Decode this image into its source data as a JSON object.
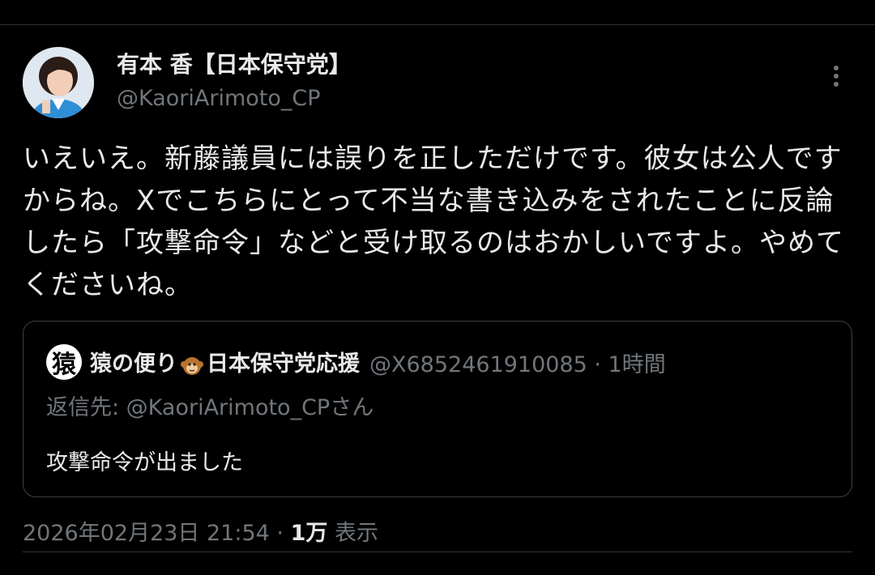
{
  "author": {
    "display_name": "有本 香【日本保守党】",
    "handle": "@KaoriArimoto_CP"
  },
  "tweet": {
    "text": "いえいえ。新藤議員には誤りを正しただけです。彼女は公人ですからね。Xでこちらにとって不当な書き込みをされたことに反論したら「攻撃命令」などと受け取るのはおかしいですよ。やめてくださいね。"
  },
  "quote": {
    "avatar_char": "猿",
    "name_part1": "猿の便り",
    "name_part2": "日本保守党応援",
    "handle_time": "@X6852461910085 · 1時間",
    "reply_to": "返信先: @KaoriArimoto_CPさん",
    "text": "攻撃命令が出ました"
  },
  "meta": {
    "timestamp": "2026年02月23日 21:54 · ",
    "views_count": "1万",
    "views_label": " 表示"
  }
}
